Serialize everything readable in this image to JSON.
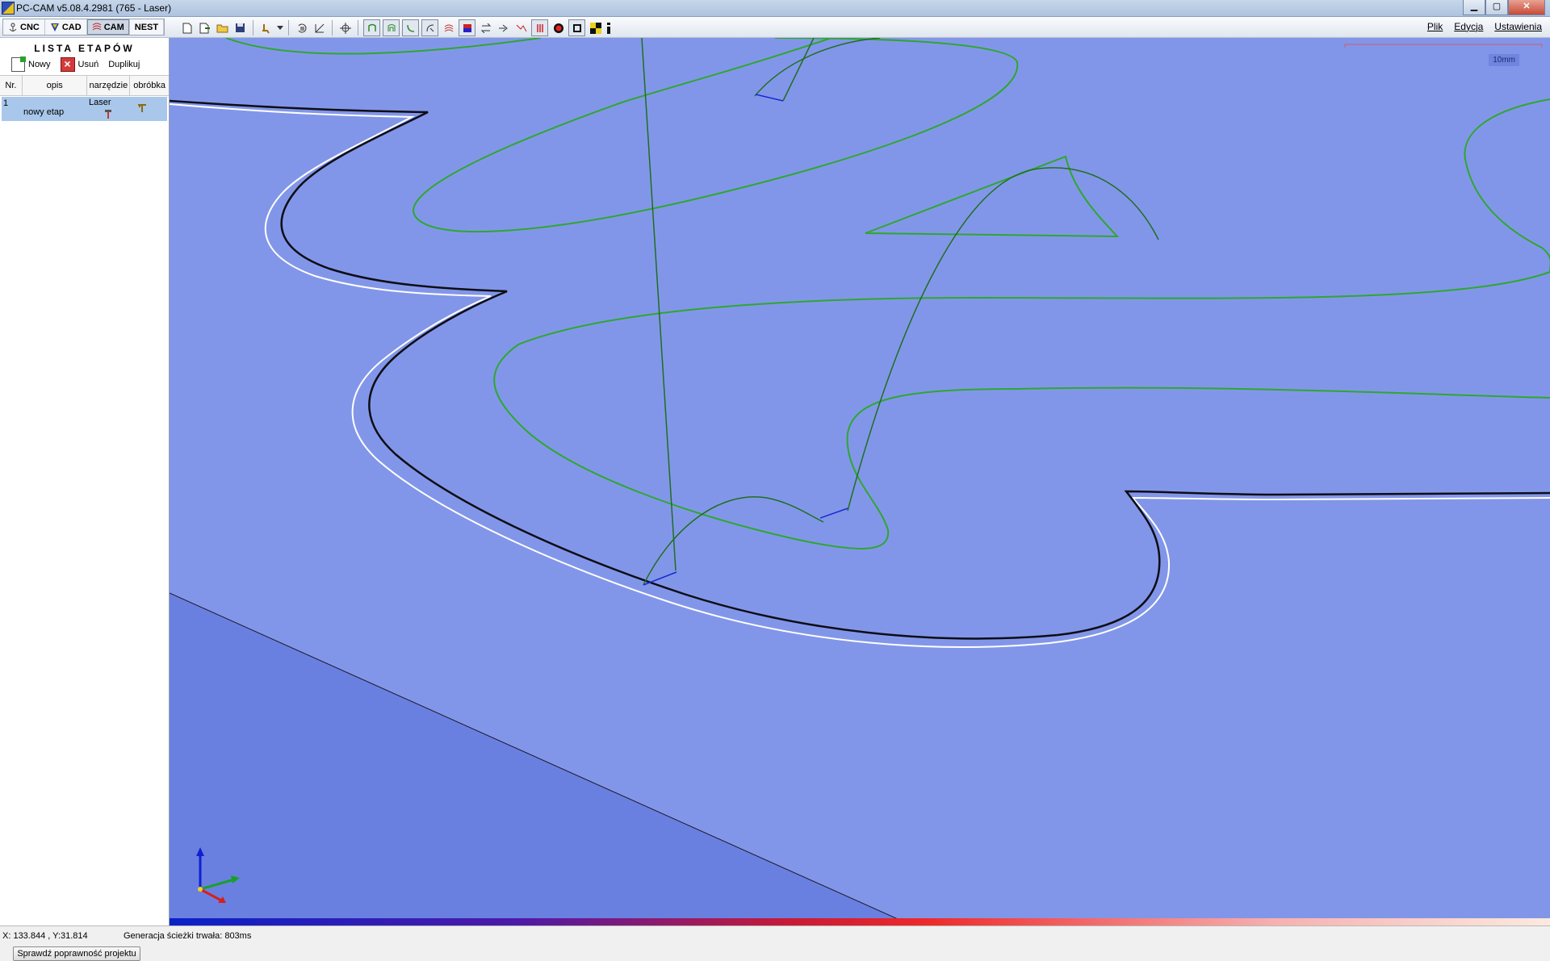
{
  "window": {
    "title": "PC-CAM v5.08.4.2981 (765 - Laser)",
    "min": "▁",
    "max": "▢",
    "close": "✕"
  },
  "modes": [
    {
      "label": "CNC"
    },
    {
      "label": "CAD"
    },
    {
      "label": "CAM"
    },
    {
      "label": "NEST"
    }
  ],
  "menu": {
    "plik": "Plik",
    "edycja": "Edycja",
    "ustawienia": "Ustawienia"
  },
  "left_panel": {
    "title": "LISTA ETAPÓW",
    "new_label": "Nowy",
    "delete_label": "Usuń",
    "duplicate_label": "Duplikuj",
    "columns": {
      "nr": "Nr.",
      "opis": "opis",
      "narzedzie": "narzędzie",
      "obrobka": "obróbka"
    },
    "rows": [
      {
        "nr": "1",
        "opis": "nowy etap",
        "narzedzie": "Laser"
      }
    ],
    "check_button": "Sprawdź poprawność projektu"
  },
  "viewport": {
    "scale_label": "10mm"
  },
  "status": {
    "coords": "X: 133.844 , Y:31.814",
    "message": "Generacja ścieżki trwała: 803ms"
  },
  "colors": {
    "workpiece": "#8296e9",
    "toolpath": "#2ea72e",
    "rapid": "#1f6e1f",
    "contour": "#111111"
  }
}
